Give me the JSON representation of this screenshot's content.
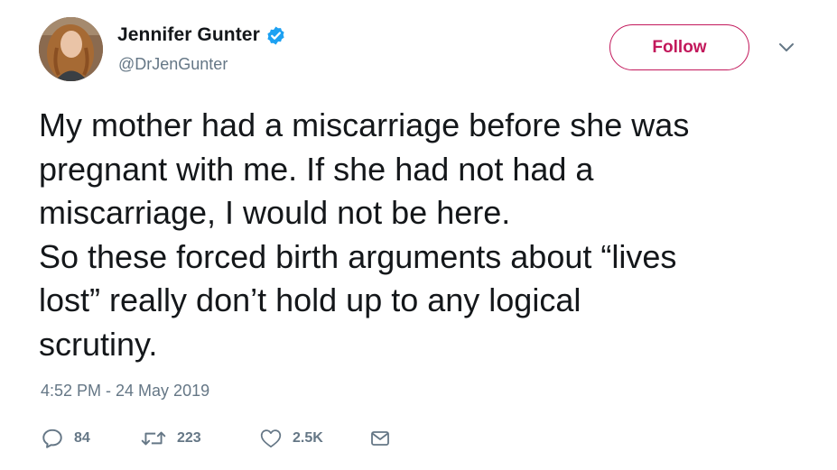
{
  "author": {
    "display_name": "Jennifer Gunter",
    "handle": "@DrJenGunter",
    "verified": true,
    "avatar_icon": "profile-photo"
  },
  "follow_button": {
    "label": "Follow"
  },
  "menu_icon": "chevron-down-icon",
  "tweet": {
    "text": "My mother had a miscarriage before she was\npregnant with me. If she had not had a\nmiscarriage, I would not be here.\nSo these forced birth arguments about “lives\nlost” really don’t hold up to any logical\nscrutiny.",
    "timestamp": "4:52 PM - 24 May 2019"
  },
  "actions": {
    "reply": {
      "icon": "reply-icon",
      "count": "84"
    },
    "retweet": {
      "icon": "retweet-icon",
      "count": "223"
    },
    "like": {
      "icon": "heart-icon",
      "count": "2.5K"
    },
    "message": {
      "icon": "envelope-icon"
    }
  },
  "colors": {
    "text": "#14171a",
    "secondary": "#657786",
    "follow_accent": "#c2185b",
    "verified_blue": "#1da1f2"
  }
}
